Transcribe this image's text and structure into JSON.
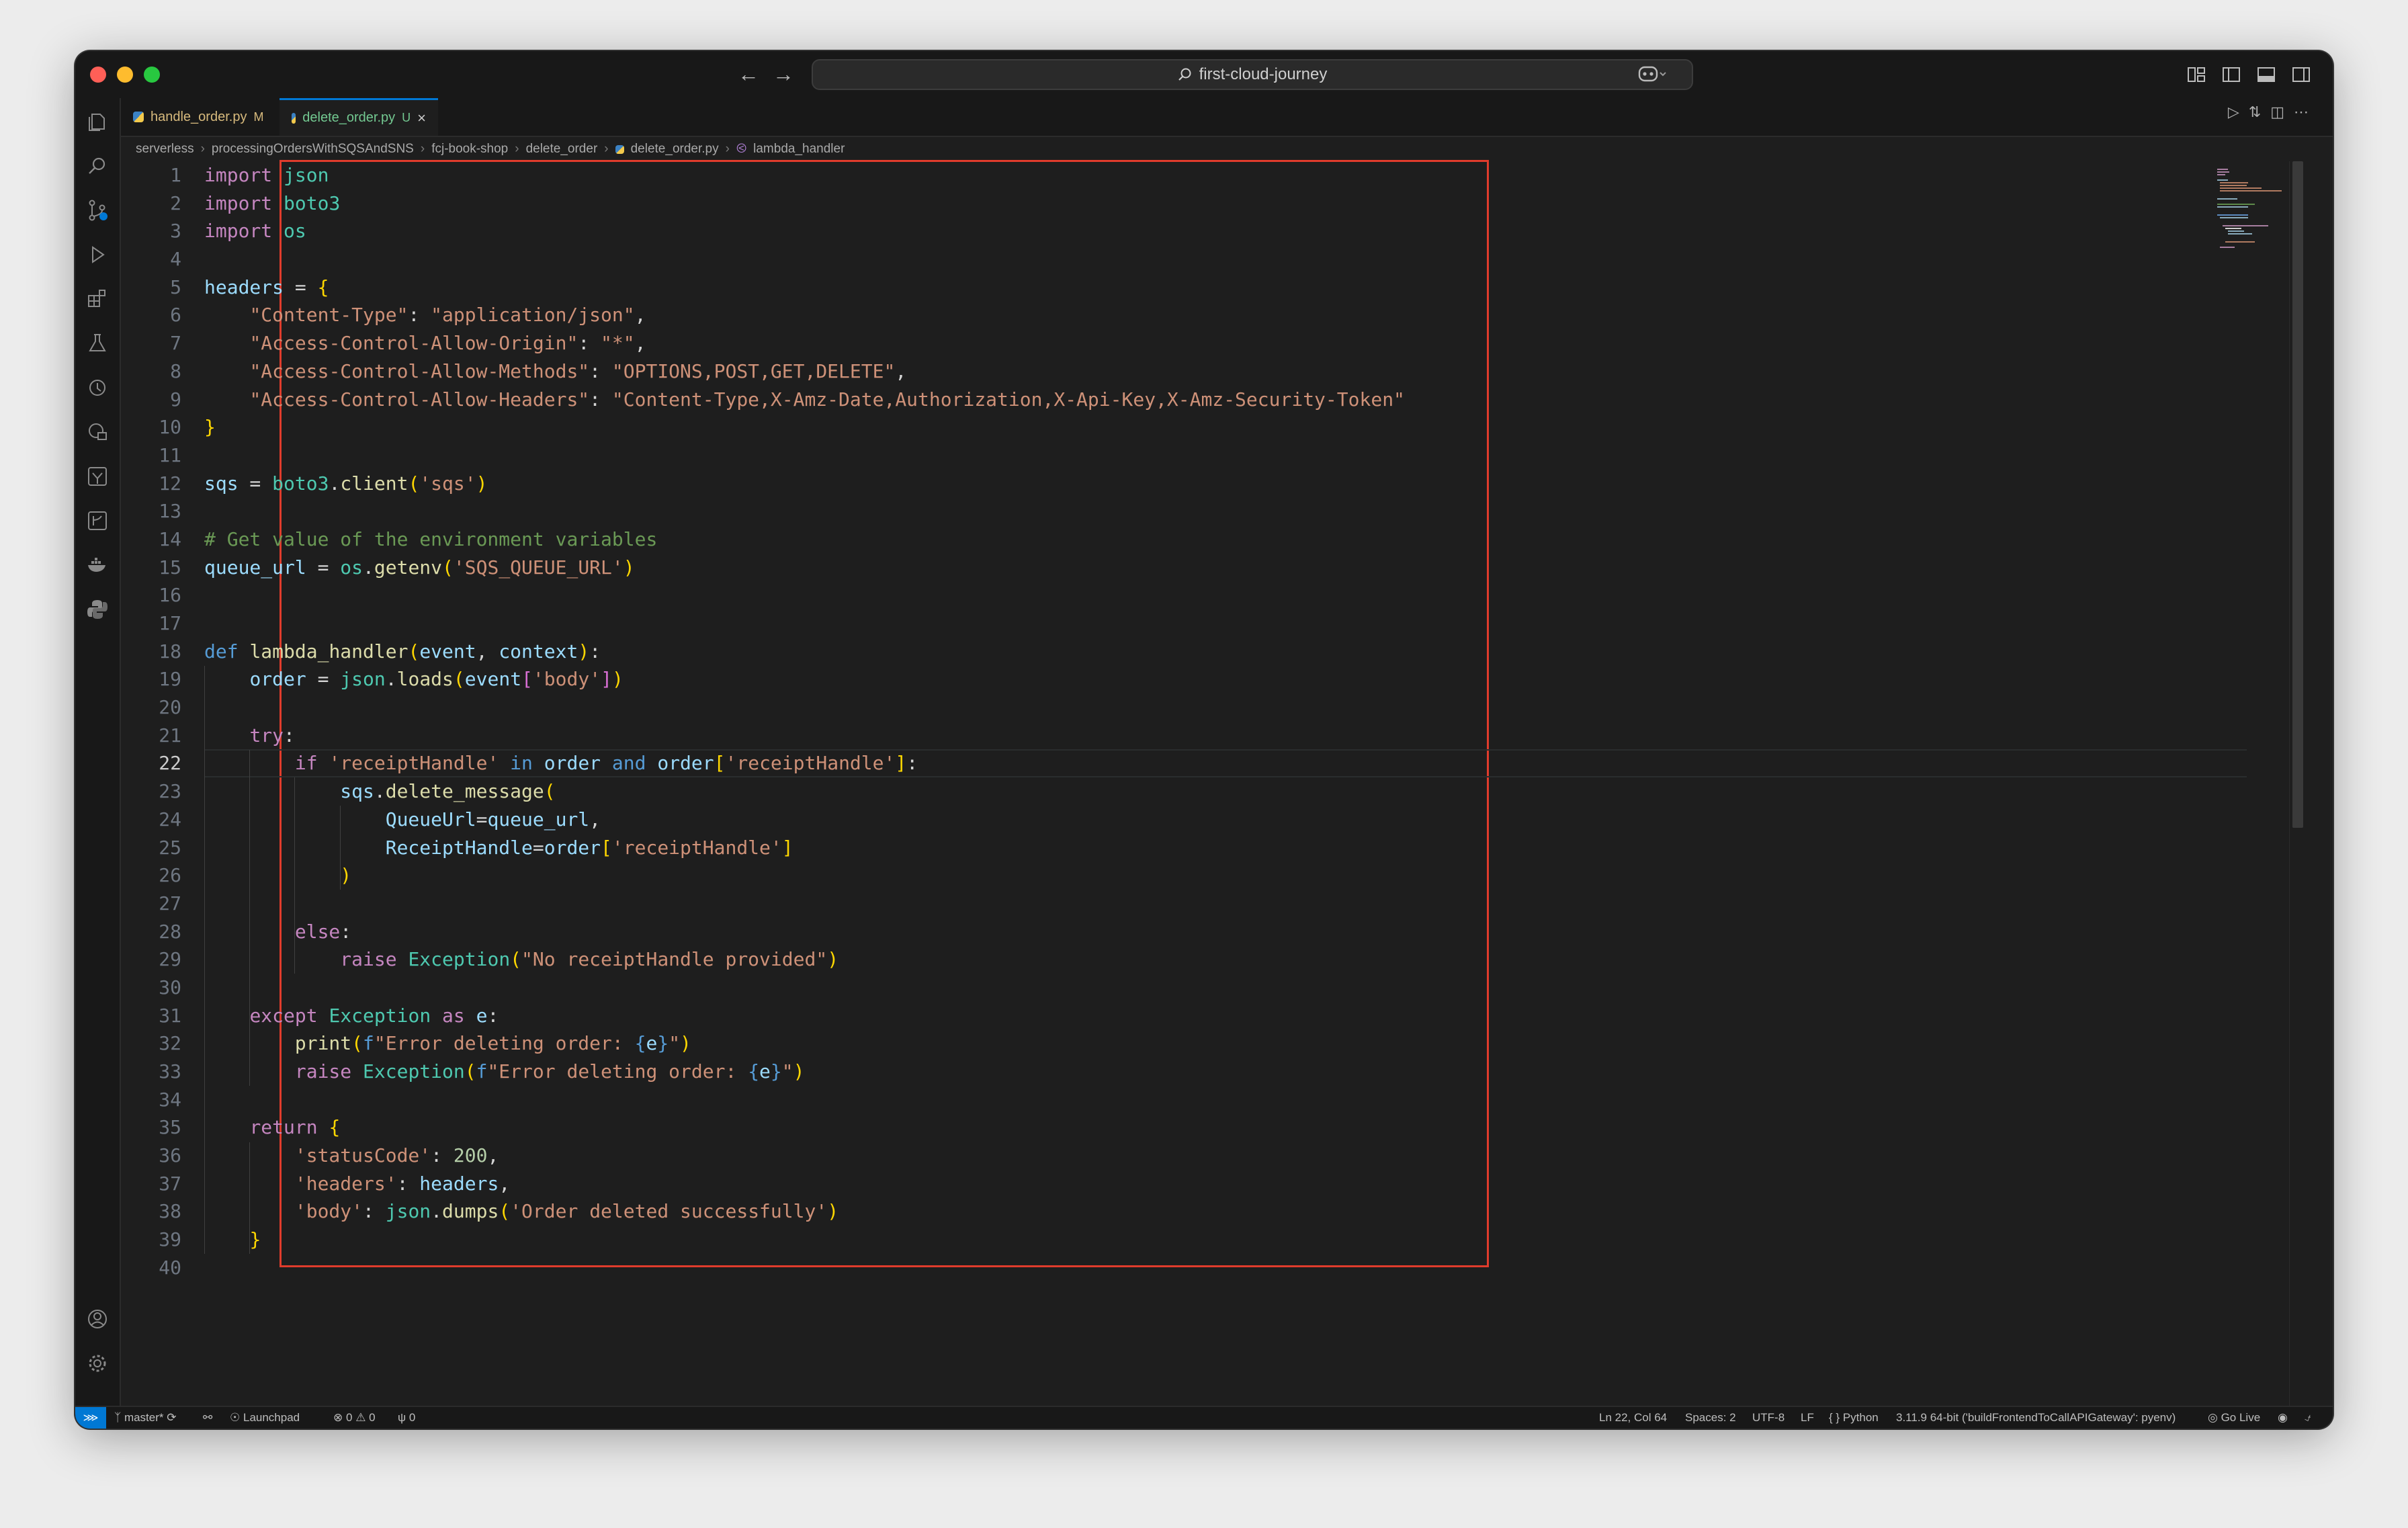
{
  "window": {
    "search_text": "first-cloud-journey"
  },
  "tabs": [
    {
      "label": "handle_order.py",
      "status": "M"
    },
    {
      "label": "delete_order.py",
      "status": "U"
    }
  ],
  "breadcrumb": [
    "serverless",
    "processingOrdersWithSQSAndSNS",
    "fcj-book-shop",
    "delete_order",
    "delete_order.py",
    "lambda_handler"
  ],
  "editor": {
    "current_line": 22,
    "lines": [
      "import json",
      "import boto3",
      "import os",
      "",
      "headers = {",
      "    \"Content-Type\": \"application/json\",",
      "    \"Access-Control-Allow-Origin\": \"*\",",
      "    \"Access-Control-Allow-Methods\": \"OPTIONS,POST,GET,DELETE\",",
      "    \"Access-Control-Allow-Headers\": \"Content-Type,X-Amz-Date,Authorization,X-Api-Key,X-Amz-Security-Token\"",
      "}",
      "",
      "sqs = boto3.client('sqs')",
      "",
      "# Get value of the environment variables",
      "queue_url = os.getenv('SQS_QUEUE_URL')",
      "",
      "",
      "def lambda_handler(event, context):",
      "    order = json.loads(event['body'])",
      "",
      "    try:",
      "        if 'receiptHandle' in order and order['receiptHandle']:",
      "            sqs.delete_message(",
      "                QueueUrl=queue_url,",
      "                ReceiptHandle=order['receiptHandle']",
      "            )",
      "",
      "        else:",
      "            raise Exception(\"No receiptHandle provided\")",
      "",
      "    except Exception as e:",
      "        print(f\"Error deleting order: {e}\")",
      "        raise Exception(f\"Error deleting order: {e}\")",
      "",
      "    return {",
      "        'statusCode': 200,",
      "        'headers': headers,",
      "        'body': json.dumps('Order deleted successfully')",
      "    }",
      ""
    ]
  },
  "statusbar": {
    "branch": "master*",
    "launchpad": "Launchpad",
    "errors": "0",
    "warnings": "0",
    "ports": "0",
    "cursor": "Ln 22, Col 64",
    "indent": "Spaces: 2",
    "encoding": "UTF-8",
    "eol": "LF",
    "language": "Python",
    "interpreter": "3.11.9 64-bit ('buildFrontendToCallAPIGateway': pyenv)",
    "golive": "Go Live"
  },
  "colors": {
    "accent": "#0078d4",
    "highlight_box": "#e03c2c"
  },
  "icons": [
    "explorer-icon",
    "search-icon",
    "source-control-icon",
    "run-debug-icon",
    "extensions-icon",
    "testing-icon",
    "timeline-icon",
    "remote-explorer-icon",
    "aws-icon",
    "git-graph-icon",
    "docker-icon",
    "python-icon",
    "account-icon",
    "settings-gear-icon"
  ]
}
